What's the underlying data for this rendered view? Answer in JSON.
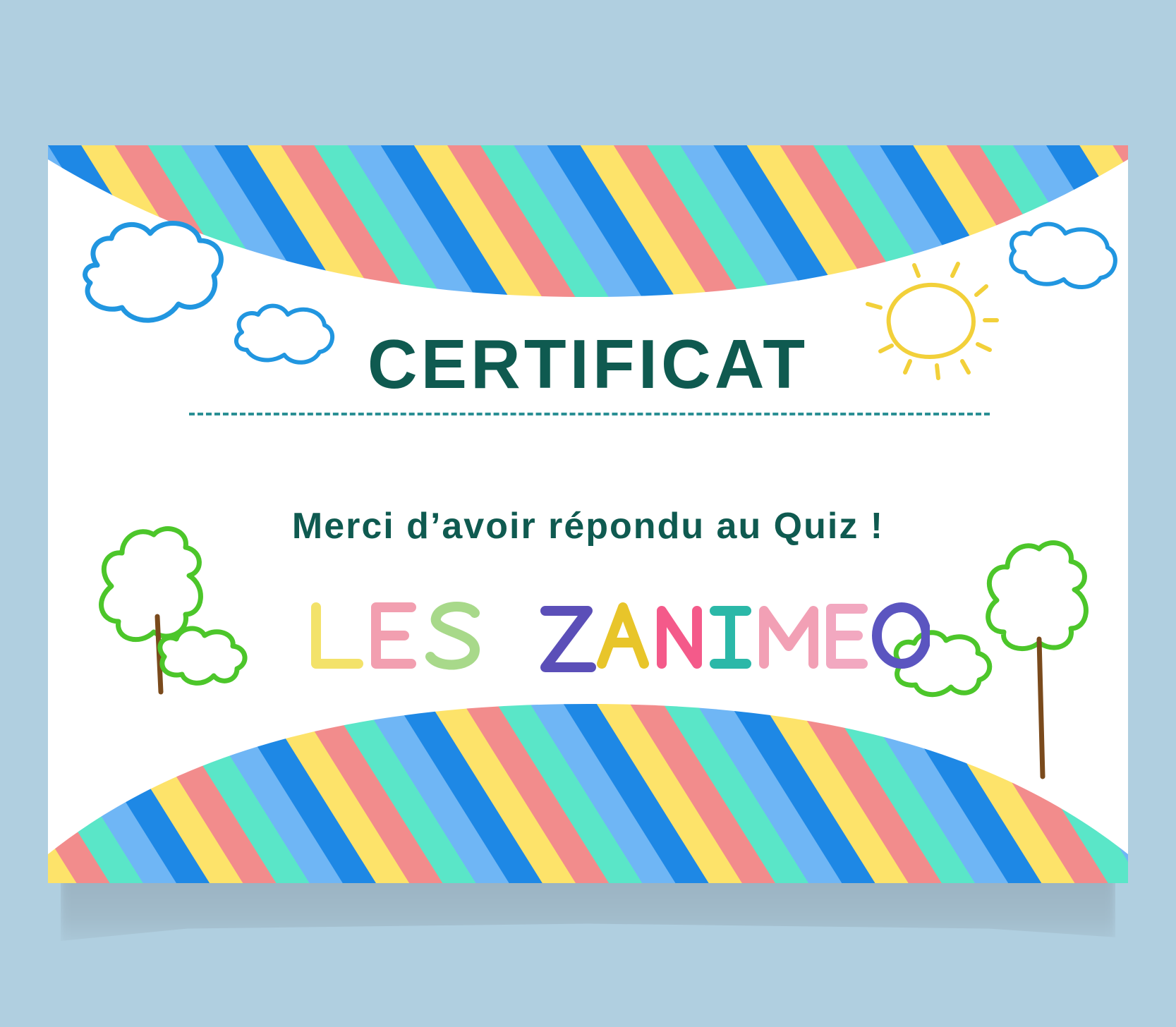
{
  "certificate": {
    "title": "CERTIFICAT",
    "message": "Merci d’avoir répondu au Quiz !",
    "brand": "LES ZANIMEO"
  },
  "colors": {
    "background": "#b0cfe0",
    "card": "#ffffff",
    "text": "#0f5a50",
    "dash": "#2a8f94",
    "stripes": [
      "#1e88e5",
      "#fde36a",
      "#f28c8c",
      "#5ae6c8",
      "#6fb6f5"
    ],
    "cloud": "#2196e0",
    "sun": "#f2d03a",
    "tree": "#4cc62a",
    "trunk": "#7a4a1c",
    "brand_letters": [
      "#f3e26a",
      "#f3e26a",
      "#f29fb0",
      "#a8d98a",
      "#5b4fb8",
      "#e8c52a",
      "#f45a8a",
      "#2bb8a8",
      "#f2a0b5",
      "#f2a8c0",
      "#5b55c0"
    ]
  },
  "icons": [
    "cloud-icon",
    "sun-icon",
    "tree-icon",
    "stripe-band"
  ]
}
